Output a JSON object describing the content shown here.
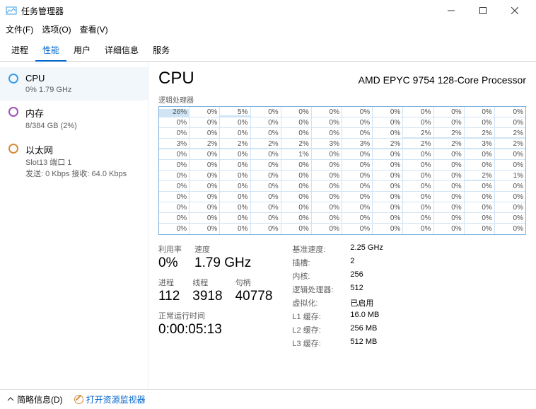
{
  "window": {
    "title": "任务管理器"
  },
  "menu": {
    "file": "文件(F)",
    "options": "选项(O)",
    "view": "查看(V)"
  },
  "tabs": {
    "processes": "进程",
    "performance": "性能",
    "users": "用户",
    "details": "详细信息",
    "services": "服务"
  },
  "sidebar": {
    "cpu": {
      "name": "CPU",
      "sub": "0% 1.79 GHz"
    },
    "memory": {
      "name": "内存",
      "sub": "8/384 GB (2%)"
    },
    "ethernet": {
      "name": "以太网",
      "sub1": "Slot13 端口 1",
      "sub2": "发送: 0 Kbps 接收: 64.0 Kbps"
    }
  },
  "main": {
    "title": "CPU",
    "model": "AMD EPYC 9754 128-Core Processor",
    "chart_label": "逻辑处理器",
    "cores": [
      [
        26,
        0,
        5,
        0,
        0,
        0,
        0,
        0,
        0,
        0,
        0,
        0
      ],
      [
        0,
        0,
        0,
        0,
        0,
        0,
        0,
        0,
        0,
        0,
        0,
        0
      ],
      [
        0,
        0,
        0,
        0,
        0,
        0,
        0,
        0,
        2,
        2,
        2,
        2
      ],
      [
        3,
        2,
        2,
        2,
        2,
        3,
        3,
        2,
        2,
        2,
        3,
        2
      ],
      [
        0,
        0,
        0,
        0,
        1,
        0,
        0,
        0,
        0,
        0,
        0,
        0
      ],
      [
        0,
        0,
        0,
        0,
        0,
        0,
        0,
        0,
        0,
        0,
        0,
        0
      ],
      [
        0,
        0,
        0,
        0,
        0,
        0,
        0,
        0,
        0,
        0,
        2,
        1
      ],
      [
        0,
        0,
        0,
        0,
        0,
        0,
        0,
        0,
        0,
        0,
        0,
        0
      ],
      [
        0,
        0,
        0,
        0,
        0,
        0,
        0,
        0,
        0,
        0,
        0,
        0
      ],
      [
        0,
        0,
        0,
        0,
        0,
        0,
        0,
        0,
        0,
        0,
        0,
        0
      ],
      [
        0,
        0,
        0,
        0,
        0,
        0,
        0,
        0,
        0,
        0,
        0,
        0
      ],
      [
        0,
        0,
        0,
        0,
        0,
        0,
        0,
        0,
        0,
        0,
        0,
        0
      ]
    ],
    "stats": {
      "util_label": "利用率",
      "util_value": "0%",
      "speed_label": "速度",
      "speed_value": "1.79 GHz",
      "proc_label": "进程",
      "proc_value": "112",
      "thread_label": "线程",
      "thread_value": "3918",
      "handle_label": "句柄",
      "handle_value": "40778",
      "uptime_label": "正常运行时间",
      "uptime_value": "0:00:05:13"
    },
    "details": {
      "base_speed_k": "基准速度:",
      "base_speed_v": "2.25 GHz",
      "sockets_k": "插槽:",
      "sockets_v": "2",
      "cores_k": "内核:",
      "cores_v": "256",
      "logical_k": "逻辑处理器:",
      "logical_v": "512",
      "virt_k": "虚拟化:",
      "virt_v": "已启用",
      "l1_k": "L1 缓存:",
      "l1_v": "16.0 MB",
      "l2_k": "L2 缓存:",
      "l2_v": "256 MB",
      "l3_k": "L3 缓存:",
      "l3_v": "512 MB"
    }
  },
  "footer": {
    "fewer": "简略信息(D)",
    "resmon": "打开资源监视器"
  }
}
